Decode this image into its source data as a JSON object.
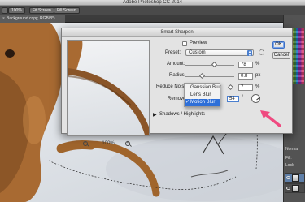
{
  "app": {
    "title": "Adobe Photoshop CC 2014",
    "options_buttons": [
      "",
      "100%",
      "Fit Screen",
      "Fill Screen"
    ],
    "document_tab": "Background copy, RGB/8*)"
  },
  "panels": {
    "labels": [
      "Normal",
      "Fill:",
      "Lock"
    ]
  },
  "dialog": {
    "title": "Smart Sharpen",
    "zoom_value": "100%",
    "preview_label": "Preview",
    "preset_label": "Preset:",
    "preset_value": "Custom",
    "amount_label": "Amount:",
    "amount_value": "78",
    "amount_unit": "%",
    "amount_fraction": 0.78,
    "radius_label": "Radius:",
    "radius_value": "0.8",
    "radius_unit": "px",
    "radius_fraction": 0.13,
    "reduce_noise_label": "Reduce Noise",
    "reduce_noise_value": "7",
    "reduce_noise_unit": "%",
    "reduce_noise_fraction": 0.07,
    "remove_label": "Remove",
    "remove_options": [
      "Gaussian Blur",
      "Lens Blur",
      "Motion Blur"
    ],
    "remove_selected": "Motion Blur",
    "angle_value": "54",
    "angle_unit": "°",
    "ok_label": "OK",
    "cancel_label": "Cancel",
    "shadows_highlights_label": "Shadows / Highlights",
    "selection_color": "#2e6fd8",
    "annotation_color": "#ef4a80"
  }
}
